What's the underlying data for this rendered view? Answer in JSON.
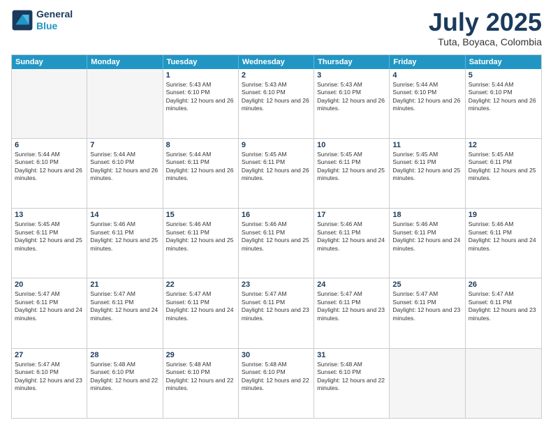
{
  "header": {
    "logo_line1": "General",
    "logo_line2": "Blue",
    "month": "July 2025",
    "location": "Tuta, Boyaca, Colombia"
  },
  "days_of_week": [
    "Sunday",
    "Monday",
    "Tuesday",
    "Wednesday",
    "Thursday",
    "Friday",
    "Saturday"
  ],
  "weeks": [
    [
      {
        "day": "",
        "empty": true
      },
      {
        "day": "",
        "empty": true
      },
      {
        "day": "1",
        "sunrise": "5:43 AM",
        "sunset": "6:10 PM",
        "daylight": "12 hours and 26 minutes."
      },
      {
        "day": "2",
        "sunrise": "5:43 AM",
        "sunset": "6:10 PM",
        "daylight": "12 hours and 26 minutes."
      },
      {
        "day": "3",
        "sunrise": "5:43 AM",
        "sunset": "6:10 PM",
        "daylight": "12 hours and 26 minutes."
      },
      {
        "day": "4",
        "sunrise": "5:44 AM",
        "sunset": "6:10 PM",
        "daylight": "12 hours and 26 minutes."
      },
      {
        "day": "5",
        "sunrise": "5:44 AM",
        "sunset": "6:10 PM",
        "daylight": "12 hours and 26 minutes."
      }
    ],
    [
      {
        "day": "6",
        "sunrise": "5:44 AM",
        "sunset": "6:10 PM",
        "daylight": "12 hours and 26 minutes."
      },
      {
        "day": "7",
        "sunrise": "5:44 AM",
        "sunset": "6:10 PM",
        "daylight": "12 hours and 26 minutes."
      },
      {
        "day": "8",
        "sunrise": "5:44 AM",
        "sunset": "6:11 PM",
        "daylight": "12 hours and 26 minutes."
      },
      {
        "day": "9",
        "sunrise": "5:45 AM",
        "sunset": "6:11 PM",
        "daylight": "12 hours and 26 minutes."
      },
      {
        "day": "10",
        "sunrise": "5:45 AM",
        "sunset": "6:11 PM",
        "daylight": "12 hours and 25 minutes."
      },
      {
        "day": "11",
        "sunrise": "5:45 AM",
        "sunset": "6:11 PM",
        "daylight": "12 hours and 25 minutes."
      },
      {
        "day": "12",
        "sunrise": "5:45 AM",
        "sunset": "6:11 PM",
        "daylight": "12 hours and 25 minutes."
      }
    ],
    [
      {
        "day": "13",
        "sunrise": "5:45 AM",
        "sunset": "6:11 PM",
        "daylight": "12 hours and 25 minutes."
      },
      {
        "day": "14",
        "sunrise": "5:46 AM",
        "sunset": "6:11 PM",
        "daylight": "12 hours and 25 minutes."
      },
      {
        "day": "15",
        "sunrise": "5:46 AM",
        "sunset": "6:11 PM",
        "daylight": "12 hours and 25 minutes."
      },
      {
        "day": "16",
        "sunrise": "5:46 AM",
        "sunset": "6:11 PM",
        "daylight": "12 hours and 25 minutes."
      },
      {
        "day": "17",
        "sunrise": "5:46 AM",
        "sunset": "6:11 PM",
        "daylight": "12 hours and 24 minutes."
      },
      {
        "day": "18",
        "sunrise": "5:46 AM",
        "sunset": "6:11 PM",
        "daylight": "12 hours and 24 minutes."
      },
      {
        "day": "19",
        "sunrise": "5:46 AM",
        "sunset": "6:11 PM",
        "daylight": "12 hours and 24 minutes."
      }
    ],
    [
      {
        "day": "20",
        "sunrise": "5:47 AM",
        "sunset": "6:11 PM",
        "daylight": "12 hours and 24 minutes."
      },
      {
        "day": "21",
        "sunrise": "5:47 AM",
        "sunset": "6:11 PM",
        "daylight": "12 hours and 24 minutes."
      },
      {
        "day": "22",
        "sunrise": "5:47 AM",
        "sunset": "6:11 PM",
        "daylight": "12 hours and 24 minutes."
      },
      {
        "day": "23",
        "sunrise": "5:47 AM",
        "sunset": "6:11 PM",
        "daylight": "12 hours and 23 minutes."
      },
      {
        "day": "24",
        "sunrise": "5:47 AM",
        "sunset": "6:11 PM",
        "daylight": "12 hours and 23 minutes."
      },
      {
        "day": "25",
        "sunrise": "5:47 AM",
        "sunset": "6:11 PM",
        "daylight": "12 hours and 23 minutes."
      },
      {
        "day": "26",
        "sunrise": "5:47 AM",
        "sunset": "6:11 PM",
        "daylight": "12 hours and 23 minutes."
      }
    ],
    [
      {
        "day": "27",
        "sunrise": "5:47 AM",
        "sunset": "6:10 PM",
        "daylight": "12 hours and 23 minutes."
      },
      {
        "day": "28",
        "sunrise": "5:48 AM",
        "sunset": "6:10 PM",
        "daylight": "12 hours and 22 minutes."
      },
      {
        "day": "29",
        "sunrise": "5:48 AM",
        "sunset": "6:10 PM",
        "daylight": "12 hours and 22 minutes."
      },
      {
        "day": "30",
        "sunrise": "5:48 AM",
        "sunset": "6:10 PM",
        "daylight": "12 hours and 22 minutes."
      },
      {
        "day": "31",
        "sunrise": "5:48 AM",
        "sunset": "6:10 PM",
        "daylight": "12 hours and 22 minutes."
      },
      {
        "day": "",
        "empty": true
      },
      {
        "day": "",
        "empty": true
      }
    ]
  ]
}
